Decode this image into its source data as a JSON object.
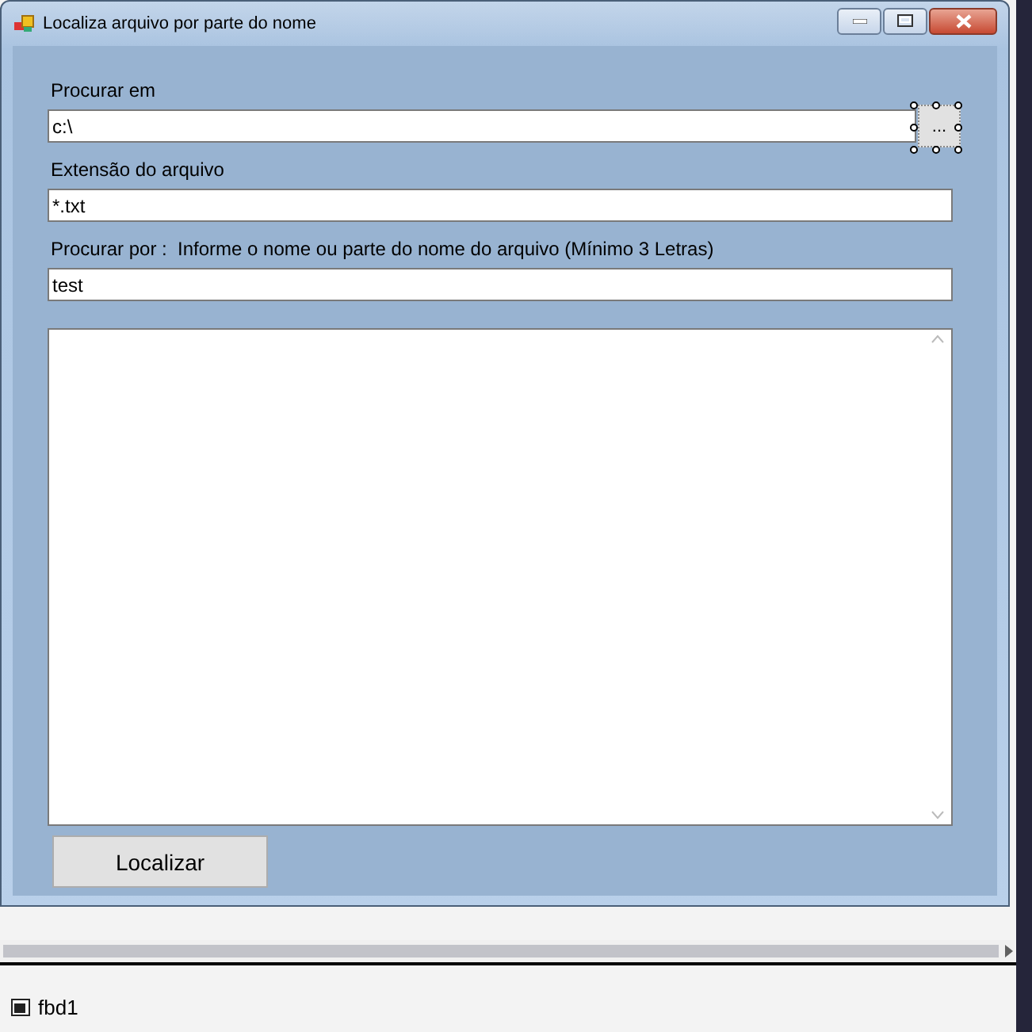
{
  "window": {
    "title": "Localiza arquivo por parte do nome"
  },
  "fields": [
    {
      "label": "Procurar em",
      "value": "c:\\",
      "has_browse": true
    },
    {
      "label": "Extensão do arquivo",
      "value": "*.txt",
      "has_browse": false
    },
    {
      "label": "Procurar por :  Informe o nome ou parte do nome do arquivo (Mínimo 3 Letras)",
      "value": "test",
      "has_browse": false
    }
  ],
  "browse_button": {
    "label": "...",
    "selected": true
  },
  "search_button": {
    "label": "Localizar"
  },
  "component_tray": [
    {
      "name": "fbd1"
    }
  ]
}
